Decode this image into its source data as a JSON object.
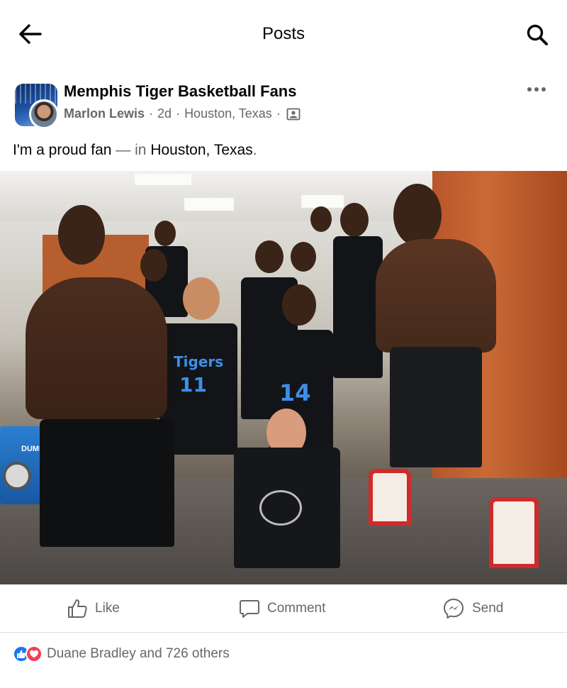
{
  "header": {
    "title": "Posts"
  },
  "post": {
    "group_name": "Memphis Tiger Basketball Fans",
    "author": "Marlon Lewis",
    "time": "2d",
    "location_meta": "Houston, Texas",
    "privacy_icon": "photo-audience-icon",
    "text": {
      "prefix": "I'm a proud fan",
      "connector": "— in",
      "location": "Houston, Texas",
      "suffix": "."
    },
    "photo_overlay_text": {
      "jersey_team": "Tigers",
      "jersey_number_1": "14",
      "jersey_number_2": "11",
      "boombox_brand": "DUMPO"
    }
  },
  "actions": {
    "like": "Like",
    "comment": "Comment",
    "send": "Send"
  },
  "reactions": {
    "summary": "Duane Bradley and 726 others"
  },
  "colors": {
    "accent": "#1877f2",
    "love": "#f33e58",
    "secondary_text": "#65676b"
  }
}
